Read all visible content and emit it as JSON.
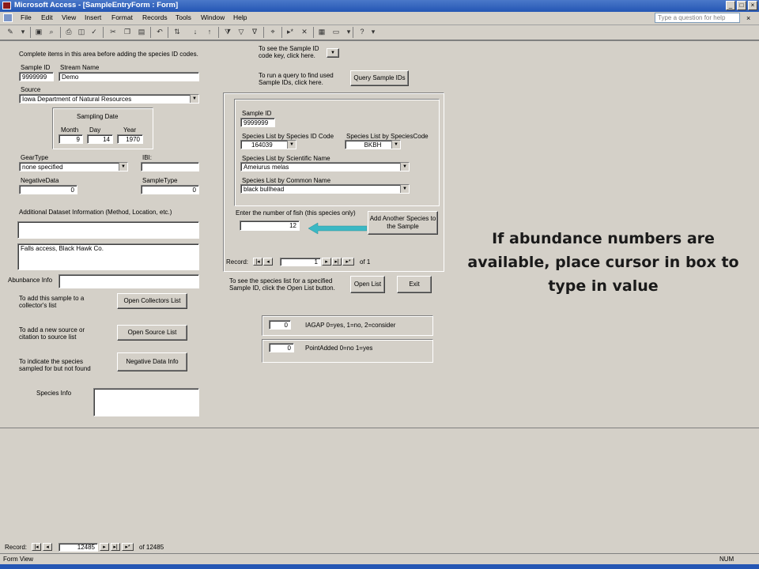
{
  "window": {
    "title": "Microsoft Access - [SampleEntryForm : Form]"
  },
  "menu": [
    "File",
    "Edit",
    "View",
    "Insert",
    "Format",
    "Records",
    "Tools",
    "Window",
    "Help"
  ],
  "help_placeholder": "Type a question for help",
  "form": {
    "intro": "Complete items in this area before adding the species ID codes.",
    "sample_id_label": "Sample ID",
    "sample_id": "9999999",
    "stream_name_label": "Stream Name",
    "stream_name": "Demo",
    "source_label": "Source",
    "source": "Iowa Department of Natural Resources",
    "sampling_date_label": "Sampling Date",
    "month_label": "Month",
    "month": "9",
    "day_label": "Day",
    "day": "14",
    "year_label": "Year",
    "year": "1970",
    "geartype_label": "GearType",
    "geartype": "none specified",
    "ibi_label": "IBI:",
    "ibi": "",
    "negativedata_label": "NegativeData",
    "negativedata": "0",
    "sampletype_label": "SampleType",
    "sampletype": "0",
    "additional_label": "Additional Dataset Information (Method, Location, etc.)",
    "additional_1": "",
    "additional_2": "Falls access, Black Hawk Co.",
    "abundance_label": "Abunbance Info",
    "abundance": "",
    "add_collector_text": "To add this sample to a collector's list",
    "open_collectors_label": "Open Collectors List",
    "add_source_text": "To add a new source or citation to source list",
    "open_source_label": "Open Source List",
    "indicate_species_text": "To indicate the species sampled for but not found",
    "negative_data_info_label": "Negative Data Info",
    "species_info_label": "Species Info",
    "species_info": ""
  },
  "right_panel": {
    "code_key_text": "To see the Sample ID code key, click here.",
    "query_text": "To run a query to find used Sample IDs, click here.",
    "query_btn": "Query Sample IDs",
    "sub": {
      "sample_id_label": "Sample ID",
      "sample_id": "9999999",
      "by_code_label": "Species List by Species ID Code",
      "by_code": "164039",
      "by_speciescode_label": "Species List by SpeciesCode",
      "by_speciescode": "BKBH",
      "by_sci_label": "Species List by Scientific Name",
      "by_sci": "Ameiurus melas",
      "by_common_label": "Species List by Common Name",
      "by_common": "black bullhead",
      "fish_count_label": "Enter the number of fish (this species only)",
      "fish_count": "12",
      "add_another_label": "Add Another Species to the Sample",
      "record_label": "Record:",
      "record_value": "1",
      "record_of": "of  1"
    },
    "species_list_text": "To see the species list for a specified Sample ID, click the Open List button.",
    "open_list_label": "Open List",
    "exit_label": "Exit",
    "iagap_value": "0",
    "iagap_text": "IAGAP  0=yes, 1=no, 2=consider",
    "pointadded_value": "0",
    "pointadded_text": "PointAdded 0=no 1=yes"
  },
  "callout": "If abundance numbers are available, place cursor in box to type in value",
  "bottom_nav": {
    "record_label": "Record:",
    "record_value": "12485",
    "record_of": "of  12485"
  },
  "status": {
    "left": "Form View",
    "right": "NUM"
  },
  "colors": {
    "face": "#d4d0c8",
    "title": "#2456b4",
    "arrow": "#3ab8c4"
  }
}
